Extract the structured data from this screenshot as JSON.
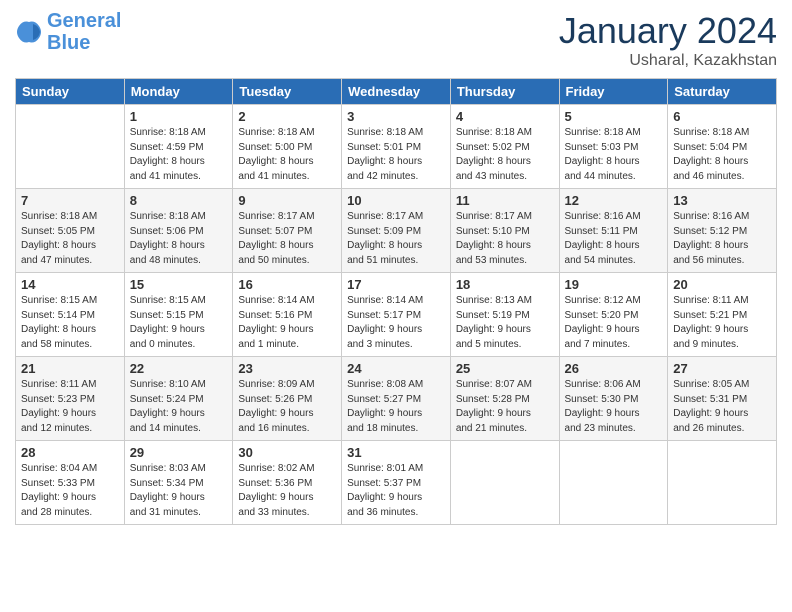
{
  "header": {
    "logo_line1": "General",
    "logo_line2": "Blue",
    "month": "January 2024",
    "location": "Usharal, Kazakhstan"
  },
  "weekdays": [
    "Sunday",
    "Monday",
    "Tuesday",
    "Wednesday",
    "Thursday",
    "Friday",
    "Saturday"
  ],
  "weeks": [
    [
      {
        "num": "",
        "info": ""
      },
      {
        "num": "1",
        "info": "Sunrise: 8:18 AM\nSunset: 4:59 PM\nDaylight: 8 hours\nand 41 minutes."
      },
      {
        "num": "2",
        "info": "Sunrise: 8:18 AM\nSunset: 5:00 PM\nDaylight: 8 hours\nand 41 minutes."
      },
      {
        "num": "3",
        "info": "Sunrise: 8:18 AM\nSunset: 5:01 PM\nDaylight: 8 hours\nand 42 minutes."
      },
      {
        "num": "4",
        "info": "Sunrise: 8:18 AM\nSunset: 5:02 PM\nDaylight: 8 hours\nand 43 minutes."
      },
      {
        "num": "5",
        "info": "Sunrise: 8:18 AM\nSunset: 5:03 PM\nDaylight: 8 hours\nand 44 minutes."
      },
      {
        "num": "6",
        "info": "Sunrise: 8:18 AM\nSunset: 5:04 PM\nDaylight: 8 hours\nand 46 minutes."
      }
    ],
    [
      {
        "num": "7",
        "info": "Sunrise: 8:18 AM\nSunset: 5:05 PM\nDaylight: 8 hours\nand 47 minutes."
      },
      {
        "num": "8",
        "info": "Sunrise: 8:18 AM\nSunset: 5:06 PM\nDaylight: 8 hours\nand 48 minutes."
      },
      {
        "num": "9",
        "info": "Sunrise: 8:17 AM\nSunset: 5:07 PM\nDaylight: 8 hours\nand 50 minutes."
      },
      {
        "num": "10",
        "info": "Sunrise: 8:17 AM\nSunset: 5:09 PM\nDaylight: 8 hours\nand 51 minutes."
      },
      {
        "num": "11",
        "info": "Sunrise: 8:17 AM\nSunset: 5:10 PM\nDaylight: 8 hours\nand 53 minutes."
      },
      {
        "num": "12",
        "info": "Sunrise: 8:16 AM\nSunset: 5:11 PM\nDaylight: 8 hours\nand 54 minutes."
      },
      {
        "num": "13",
        "info": "Sunrise: 8:16 AM\nSunset: 5:12 PM\nDaylight: 8 hours\nand 56 minutes."
      }
    ],
    [
      {
        "num": "14",
        "info": "Sunrise: 8:15 AM\nSunset: 5:14 PM\nDaylight: 8 hours\nand 58 minutes."
      },
      {
        "num": "15",
        "info": "Sunrise: 8:15 AM\nSunset: 5:15 PM\nDaylight: 9 hours\nand 0 minutes."
      },
      {
        "num": "16",
        "info": "Sunrise: 8:14 AM\nSunset: 5:16 PM\nDaylight: 9 hours\nand 1 minute."
      },
      {
        "num": "17",
        "info": "Sunrise: 8:14 AM\nSunset: 5:17 PM\nDaylight: 9 hours\nand 3 minutes."
      },
      {
        "num": "18",
        "info": "Sunrise: 8:13 AM\nSunset: 5:19 PM\nDaylight: 9 hours\nand 5 minutes."
      },
      {
        "num": "19",
        "info": "Sunrise: 8:12 AM\nSunset: 5:20 PM\nDaylight: 9 hours\nand 7 minutes."
      },
      {
        "num": "20",
        "info": "Sunrise: 8:11 AM\nSunset: 5:21 PM\nDaylight: 9 hours\nand 9 minutes."
      }
    ],
    [
      {
        "num": "21",
        "info": "Sunrise: 8:11 AM\nSunset: 5:23 PM\nDaylight: 9 hours\nand 12 minutes."
      },
      {
        "num": "22",
        "info": "Sunrise: 8:10 AM\nSunset: 5:24 PM\nDaylight: 9 hours\nand 14 minutes."
      },
      {
        "num": "23",
        "info": "Sunrise: 8:09 AM\nSunset: 5:26 PM\nDaylight: 9 hours\nand 16 minutes."
      },
      {
        "num": "24",
        "info": "Sunrise: 8:08 AM\nSunset: 5:27 PM\nDaylight: 9 hours\nand 18 minutes."
      },
      {
        "num": "25",
        "info": "Sunrise: 8:07 AM\nSunset: 5:28 PM\nDaylight: 9 hours\nand 21 minutes."
      },
      {
        "num": "26",
        "info": "Sunrise: 8:06 AM\nSunset: 5:30 PM\nDaylight: 9 hours\nand 23 minutes."
      },
      {
        "num": "27",
        "info": "Sunrise: 8:05 AM\nSunset: 5:31 PM\nDaylight: 9 hours\nand 26 minutes."
      }
    ],
    [
      {
        "num": "28",
        "info": "Sunrise: 8:04 AM\nSunset: 5:33 PM\nDaylight: 9 hours\nand 28 minutes."
      },
      {
        "num": "29",
        "info": "Sunrise: 8:03 AM\nSunset: 5:34 PM\nDaylight: 9 hours\nand 31 minutes."
      },
      {
        "num": "30",
        "info": "Sunrise: 8:02 AM\nSunset: 5:36 PM\nDaylight: 9 hours\nand 33 minutes."
      },
      {
        "num": "31",
        "info": "Sunrise: 8:01 AM\nSunset: 5:37 PM\nDaylight: 9 hours\nand 36 minutes."
      },
      {
        "num": "",
        "info": ""
      },
      {
        "num": "",
        "info": ""
      },
      {
        "num": "",
        "info": ""
      }
    ]
  ]
}
